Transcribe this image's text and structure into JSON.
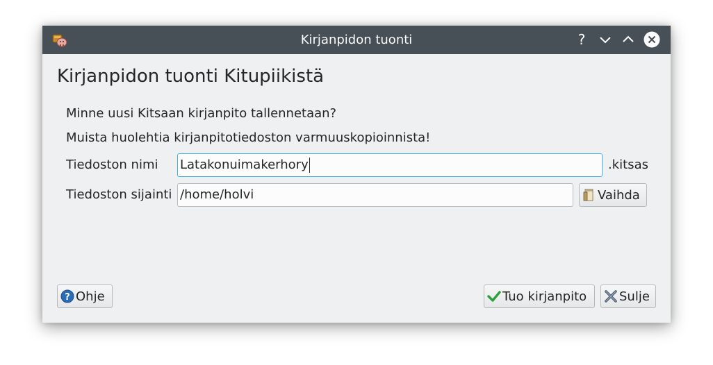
{
  "window": {
    "title": "Kirjanpidon tuonti",
    "controls": {
      "help": "?",
      "minimize": "minimize",
      "maximize": "maximize",
      "close": "close"
    }
  },
  "dialog": {
    "heading": "Kirjanpidon tuonti Kitupiikistä",
    "question": "Minne uusi Kitsaan kirjanpito tallennetaan?",
    "reminder": "Muista huolehtia kirjanpitotiedoston varmuuskopioinnista!",
    "file_name": {
      "label": "Tiedoston nimi",
      "value": "Latakonuimakerhory",
      "suffix": ".kitsas"
    },
    "file_location": {
      "label": "Tiedoston sijainti",
      "value": "/home/holvi",
      "change_button": "Vaihda"
    }
  },
  "buttons": {
    "help": "Ohje",
    "import": "Tuo kirjanpito",
    "close": "Sulje"
  },
  "icons": {
    "app": "app-icon",
    "help": "help-circle-icon",
    "folder": "folder-icon",
    "check": "checkmark-icon",
    "close": "x-icon"
  },
  "colors": {
    "titlebar": "#475057",
    "window_bg": "#eff0f1",
    "focus": "#3daee9",
    "check_green": "#2ca03c",
    "help_blue": "#2b6cb8"
  }
}
